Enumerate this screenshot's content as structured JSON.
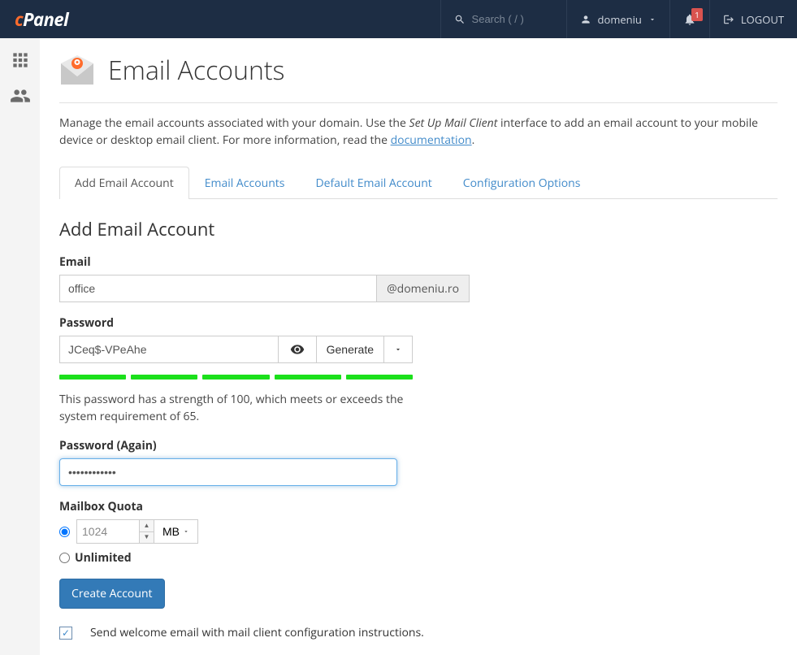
{
  "topbar": {
    "search_placeholder": "Search ( / )",
    "username": "domeniu",
    "notifications_count": "1",
    "logout_label": "LOGOUT"
  },
  "page": {
    "title": "Email Accounts",
    "intro_prefix": "Manage the email accounts associated with your domain. Use the ",
    "intro_em": "Set Up Mail Client",
    "intro_mid": " interface to add an email account to your mobile device or desktop email client. For more information, read the ",
    "intro_link": "documentation",
    "intro_suffix": "."
  },
  "tabs": {
    "add": "Add Email Account",
    "list": "Email Accounts",
    "default": "Default Email Account",
    "config": "Configuration Options"
  },
  "form": {
    "section_title": "Add Email Account",
    "email_label": "Email",
    "email_value": "office",
    "domain_addon": "@domeniu.ro",
    "password_label": "Password",
    "password_value": "JCeq$-VPeAhe",
    "generate_label": "Generate",
    "strength_text": "This password has a strength of 100, which meets or exceeds the system requirement of 65.",
    "password_again_label": "Password (Again)",
    "password_again_value": "••••••••••••",
    "quota_label": "Mailbox Quota",
    "quota_value": "1024",
    "quota_unit": "MB",
    "unlimited_label": "Unlimited",
    "submit_label": "Create Account",
    "welcome_label": "Send welcome email with mail client configuration instructions."
  }
}
